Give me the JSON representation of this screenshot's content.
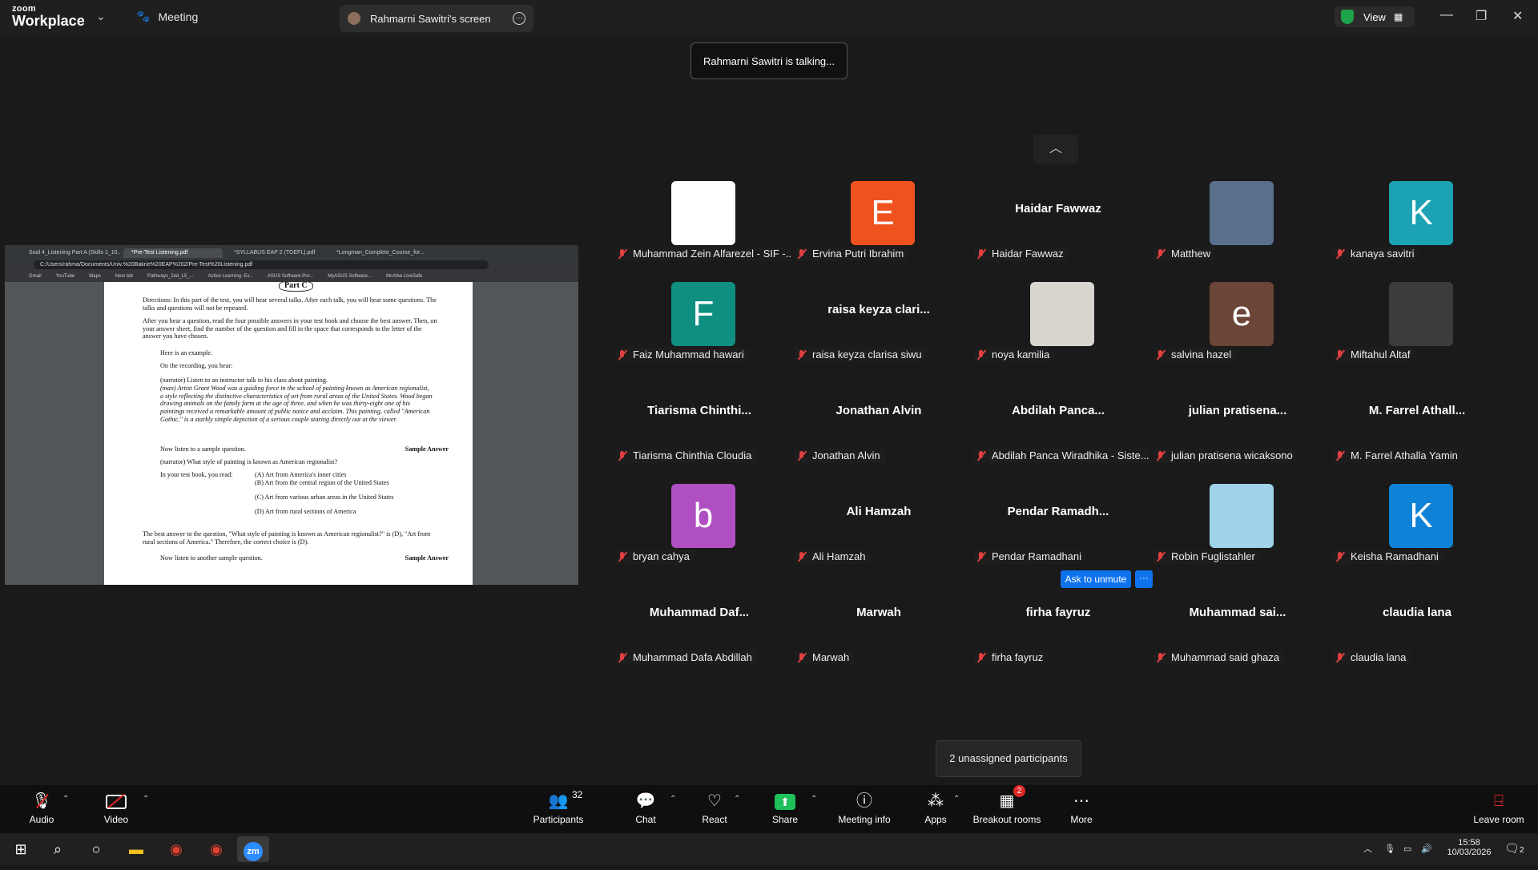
{
  "titlebar": {
    "logo_small": "zoom",
    "logo_big": "Workplace",
    "meeting_label": "Meeting",
    "screen_tab": "Rahmarni Sawitri's screen",
    "view_label": "View"
  },
  "talking_banner": "Rahmarni Sawitri is talking...",
  "shared_screen": {
    "browser_tabs": [
      "Soal 4_Listening Part A (Skills 1_10...",
      "*Pre-Test Listening.pdf",
      "*SYLLABUS EAP 2 (TOEFL).pdf",
      "*Longman_Complete_Course_for..."
    ],
    "url": "C:/Users/rahma/Documents/Univ.%20Bakrie%20EAP%202/Pre-Test%20Listening.pdf",
    "bookmarks": [
      "Gmail",
      "YouTube",
      "Maps",
      "New tab",
      "Pathways_2ed_L5_...",
      "Active Learning: Ev...",
      "ASUS Software Por...",
      "MyASUS Software...",
      "McAfee LiveSafe"
    ],
    "pdf": {
      "part": "Part C",
      "directions": "Directions: In this part of the test, you will hear several talks. After each talk, you will hear some questions. The talks and questions will not be repeated.",
      "after": "After you hear a question, read the four possible answers in your test book and choose the best answer. Then, on your answer sheet, find the number of the question and fill in the space that corresponds to the letter of the answer you have chosen.",
      "example": "Here is an example.",
      "recording": "On the recording, you hear:",
      "narrator_line": "(narrator)   Listen to an instructor talk to his class about painting.",
      "man_line": "(man)   Artist Grant Wood was a guiding force in the school of painting known as American regionalist, a style reflecting the distinctive characteristics of art from rural areas of the United States. Wood began drawing animals on the family farm at the age of three, and when he was thirty-eight one of his paintings received a remarkable amount of public notice and acclaim. This painting, called \"American Gothic,\" is a starkly simple depiction of a serious couple staring directly out at the viewer.",
      "listen_sample": "Now listen to a sample question.",
      "sample_answer": "Sample Answer",
      "question": "(narrator)   What style of painting is known as American regionalist?",
      "you_read": "In your test book, you read:",
      "options": [
        "(A)  Art from America's inner cities",
        "(B)  Art from the central region of the United States",
        "(C)  Art from various urban areas in the United States",
        "(D)  Art from rural sections of America"
      ],
      "best_answer": "The best answer to the question, \"What style of painting is known as American regionalist?\" is (D), \"Art from rural sections of America.\" Therefore, the correct choice is (D).",
      "another": "Now listen to another sample question."
    }
  },
  "participants": [
    {
      "label": "Muhammad Zein Alfarezel - SIF -...",
      "tile": "image",
      "tile_color": "#ffffff",
      "display": ""
    },
    {
      "label": "Ervina Putri Ibrahim",
      "tile": "letter",
      "letter": "E",
      "tile_color": "#f0521f"
    },
    {
      "label": "Haidar Fawwaz",
      "tile": "name",
      "display": "Haidar Fawwaz"
    },
    {
      "label": "Matthew",
      "tile": "image",
      "tile_color": "#5a6f8c"
    },
    {
      "label": "kanaya savitri",
      "tile": "letter",
      "letter": "K",
      "tile_color": "#1ba3b3"
    },
    {
      "label": "Faiz Muhammad hawari",
      "tile": "letter",
      "letter": "F",
      "tile_color": "#0f8f80"
    },
    {
      "label": "raisa keyza clarisa siwu",
      "tile": "name",
      "display": "raisa  keyza  clari..."
    },
    {
      "label": "noya kamilia",
      "tile": "image",
      "tile_color": "#d9d6d0"
    },
    {
      "label": "salvina hazel",
      "tile": "letter",
      "letter": "e",
      "tile_color": "#6b4538"
    },
    {
      "label": "Miftahul Altaf",
      "tile": "image",
      "tile_color": "#3c3c3c"
    },
    {
      "label": "Tiarisma Chinthia Cloudia",
      "tile": "name",
      "display": "Tiarisma  Chinthi..."
    },
    {
      "label": "Jonathan Alvin",
      "tile": "name",
      "display": "Jonathan Alvin"
    },
    {
      "label": "Abdilah Panca Wiradhika - Siste...",
      "tile": "name",
      "display": "Abdilah  Panca..."
    },
    {
      "label": "julian pratisena wicaksono",
      "tile": "name",
      "display": "julian  pratisena..."
    },
    {
      "label": "M. Farrel Athalla Yamin",
      "tile": "name",
      "display": "M. Farrel  Athall..."
    },
    {
      "label": "bryan cahya",
      "tile": "letter",
      "letter": "b",
      "tile_color": "#b04fc2"
    },
    {
      "label": "Ali Hamzah",
      "tile": "name",
      "display": "Ali Hamzah"
    },
    {
      "label": "Pendar Ramadhani",
      "tile": "name",
      "display": "Pendar  Ramadh..."
    },
    {
      "label": "Robin Fuglistahler",
      "tile": "image",
      "tile_color": "#9fd3ea"
    },
    {
      "label": "Keisha Ramadhani",
      "tile": "letter",
      "letter": "K",
      "tile_color": "#0e82d6"
    },
    {
      "label": "Muhammad Dafa Abdillah",
      "tile": "name",
      "display": "Muhammad  Daf..."
    },
    {
      "label": "Marwah",
      "tile": "name",
      "display": "Marwah"
    },
    {
      "label": "firha fayruz",
      "tile": "name",
      "display": "firha  fayruz"
    },
    {
      "label": "Muhammad said ghaza",
      "tile": "name",
      "display": "Muhammad  sai..."
    },
    {
      "label": "claudia lana",
      "tile": "name",
      "display": "claudia  lana"
    }
  ],
  "ask_to_unmute": "Ask to unmute",
  "ask_more": "···",
  "unassigned_tooltip": "2 unassigned participants",
  "toolbar": {
    "audio": "Audio",
    "video": "Video",
    "participants": "Participants",
    "participants_count": "32",
    "chat": "Chat",
    "react": "React",
    "share": "Share",
    "meeting_info": "Meeting info",
    "apps": "Apps",
    "breakout_rooms": "Breakout rooms",
    "breakout_badge": "2",
    "more": "More",
    "leave_room": "Leave room"
  },
  "taskbar": {
    "time": "15:58",
    "date": "10/03/2026",
    "notification_count": "2",
    "zoom_label": "zm"
  }
}
